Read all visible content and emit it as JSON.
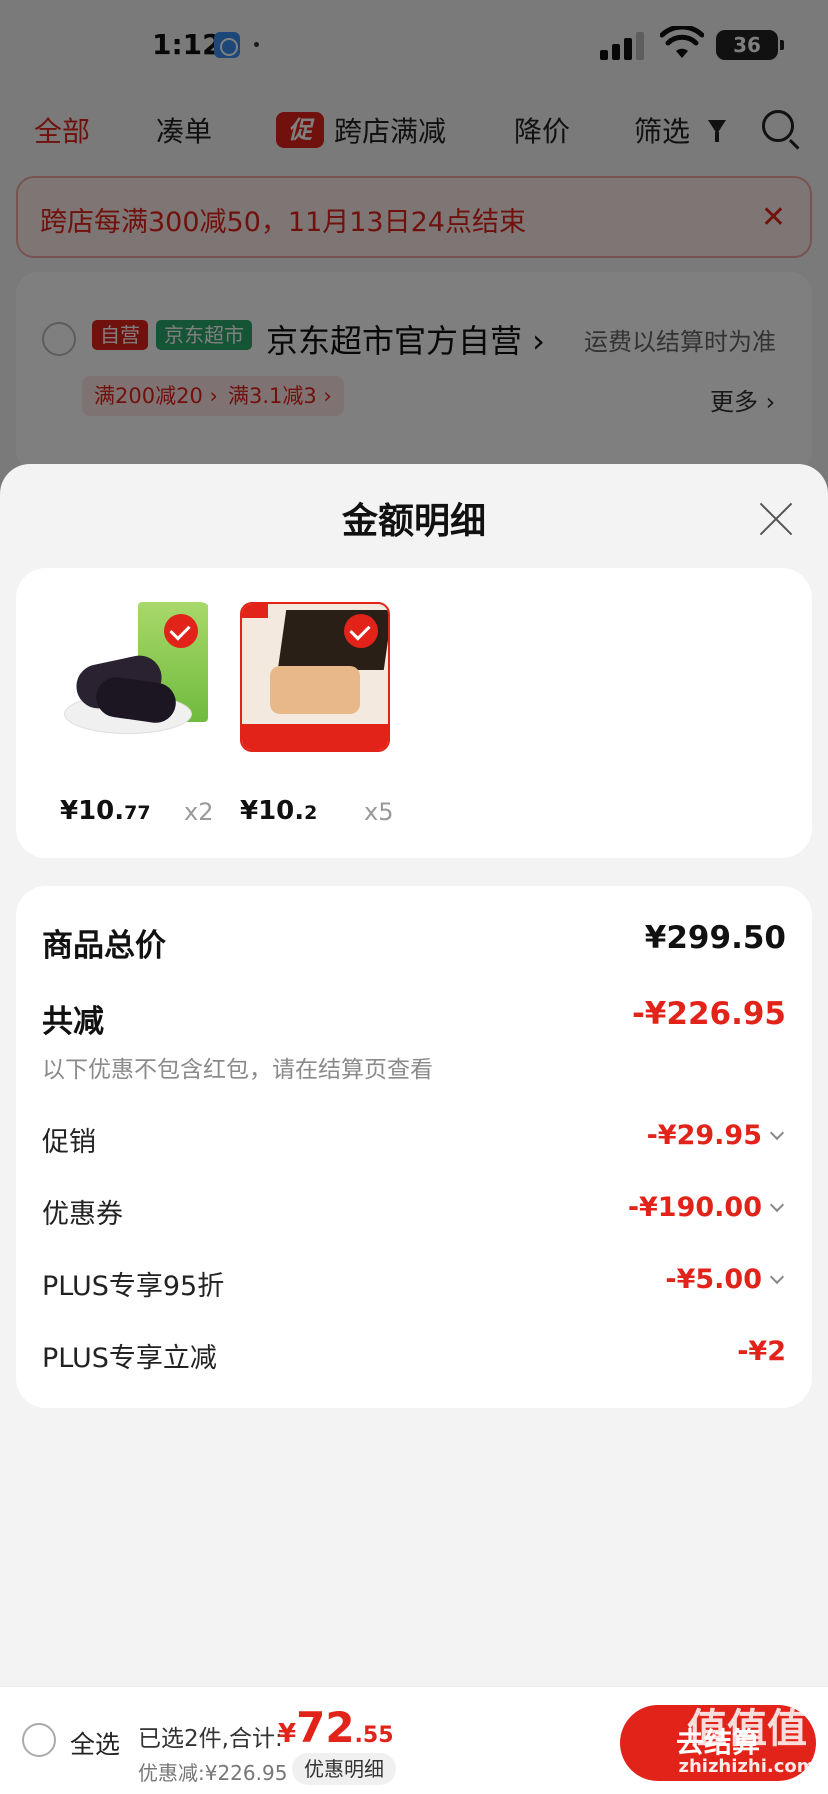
{
  "status_bar": {
    "time": "1:12",
    "battery": "36"
  },
  "filter_bar": {
    "tabs": [
      "全部",
      "凑单",
      "跨店满减",
      "降价",
      "筛选"
    ],
    "promo_badge": "促"
  },
  "notice": {
    "text": "跨店每满300减50，11月13日24点结束",
    "close": "✕"
  },
  "store": {
    "badge_self": "自营",
    "badge_market": "京东超市",
    "name": "京东超市官方自营 ›",
    "shipping": "运费以结算时为准",
    "deals": [
      "满200减20 ›",
      "满3.1减3 ›"
    ],
    "more": "更多 ›"
  },
  "sheet": {
    "title": "金额明细",
    "products": [
      {
        "name": "黑糯玉米",
        "price_int": "¥10.",
        "price_dec": "77",
        "qty": "x2"
      },
      {
        "name": "黑猪小方午餐肉",
        "price_int": "¥10.",
        "price_dec": "2",
        "qty": "x5"
      }
    ],
    "summary": {
      "total_label": "商品总价",
      "total_value": "¥299.50",
      "discount_label": "共减",
      "discount_value": "-¥226.95",
      "note": "以下优惠不包含红包，请在结算页查看",
      "rows": [
        {
          "label": "促销",
          "value": "-¥29.95"
        },
        {
          "label": "优惠券",
          "value": "-¥190.00"
        },
        {
          "label": "PLUS专享95折",
          "value": "-¥5.00"
        },
        {
          "label": "PLUS专享立减",
          "value": "-¥2"
        }
      ]
    }
  },
  "bottom_bar": {
    "select_all": "全选",
    "selected": "已选2件,合计:",
    "currency": "¥",
    "total_int": "72",
    "total_dec": ".55",
    "saved": "优惠减:¥226.95",
    "detail_button": "优惠明细",
    "checkout_button": "去结算"
  },
  "watermark": {
    "text": "值值值",
    "url": "zhizhizhi.com"
  },
  "colors": {
    "accent": "#e2231a",
    "market_green": "#2aa86a",
    "sheet_bg": "#f3f3f3"
  }
}
